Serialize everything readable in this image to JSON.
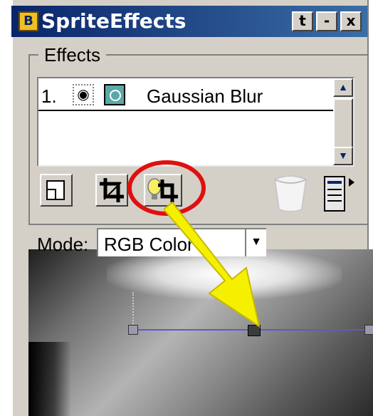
{
  "window": {
    "title": "SpriteEffects",
    "title_icon_glyph": "B",
    "controls": [
      "t",
      "-",
      "x"
    ]
  },
  "effects_group": {
    "label": "Effects",
    "list": [
      {
        "index": "1.",
        "visible": true,
        "name": "Gaussian Blur"
      }
    ],
    "scroll_up_glyph": "▲",
    "scroll_down_glyph": "▼"
  },
  "toolbar": {
    "icons": [
      "new-effect-icon",
      "crop-icon",
      "lightbulb-crop-icon",
      "trash-icon",
      "options-icon"
    ],
    "highlighted": "lightbulb-crop-icon"
  },
  "mode": {
    "label": "Mode:",
    "value": "RGB Color",
    "arrow_glyph": "▼"
  },
  "annotation": {
    "circle_color": "#e01010",
    "arrow_color": "#f5f000"
  },
  "colors": {
    "title_bar_start": "#0a246a",
    "title_bar_end": "#3a6ea5",
    "panel_bg": "#d4d0c8",
    "selection_line": "#5a5ad2"
  }
}
